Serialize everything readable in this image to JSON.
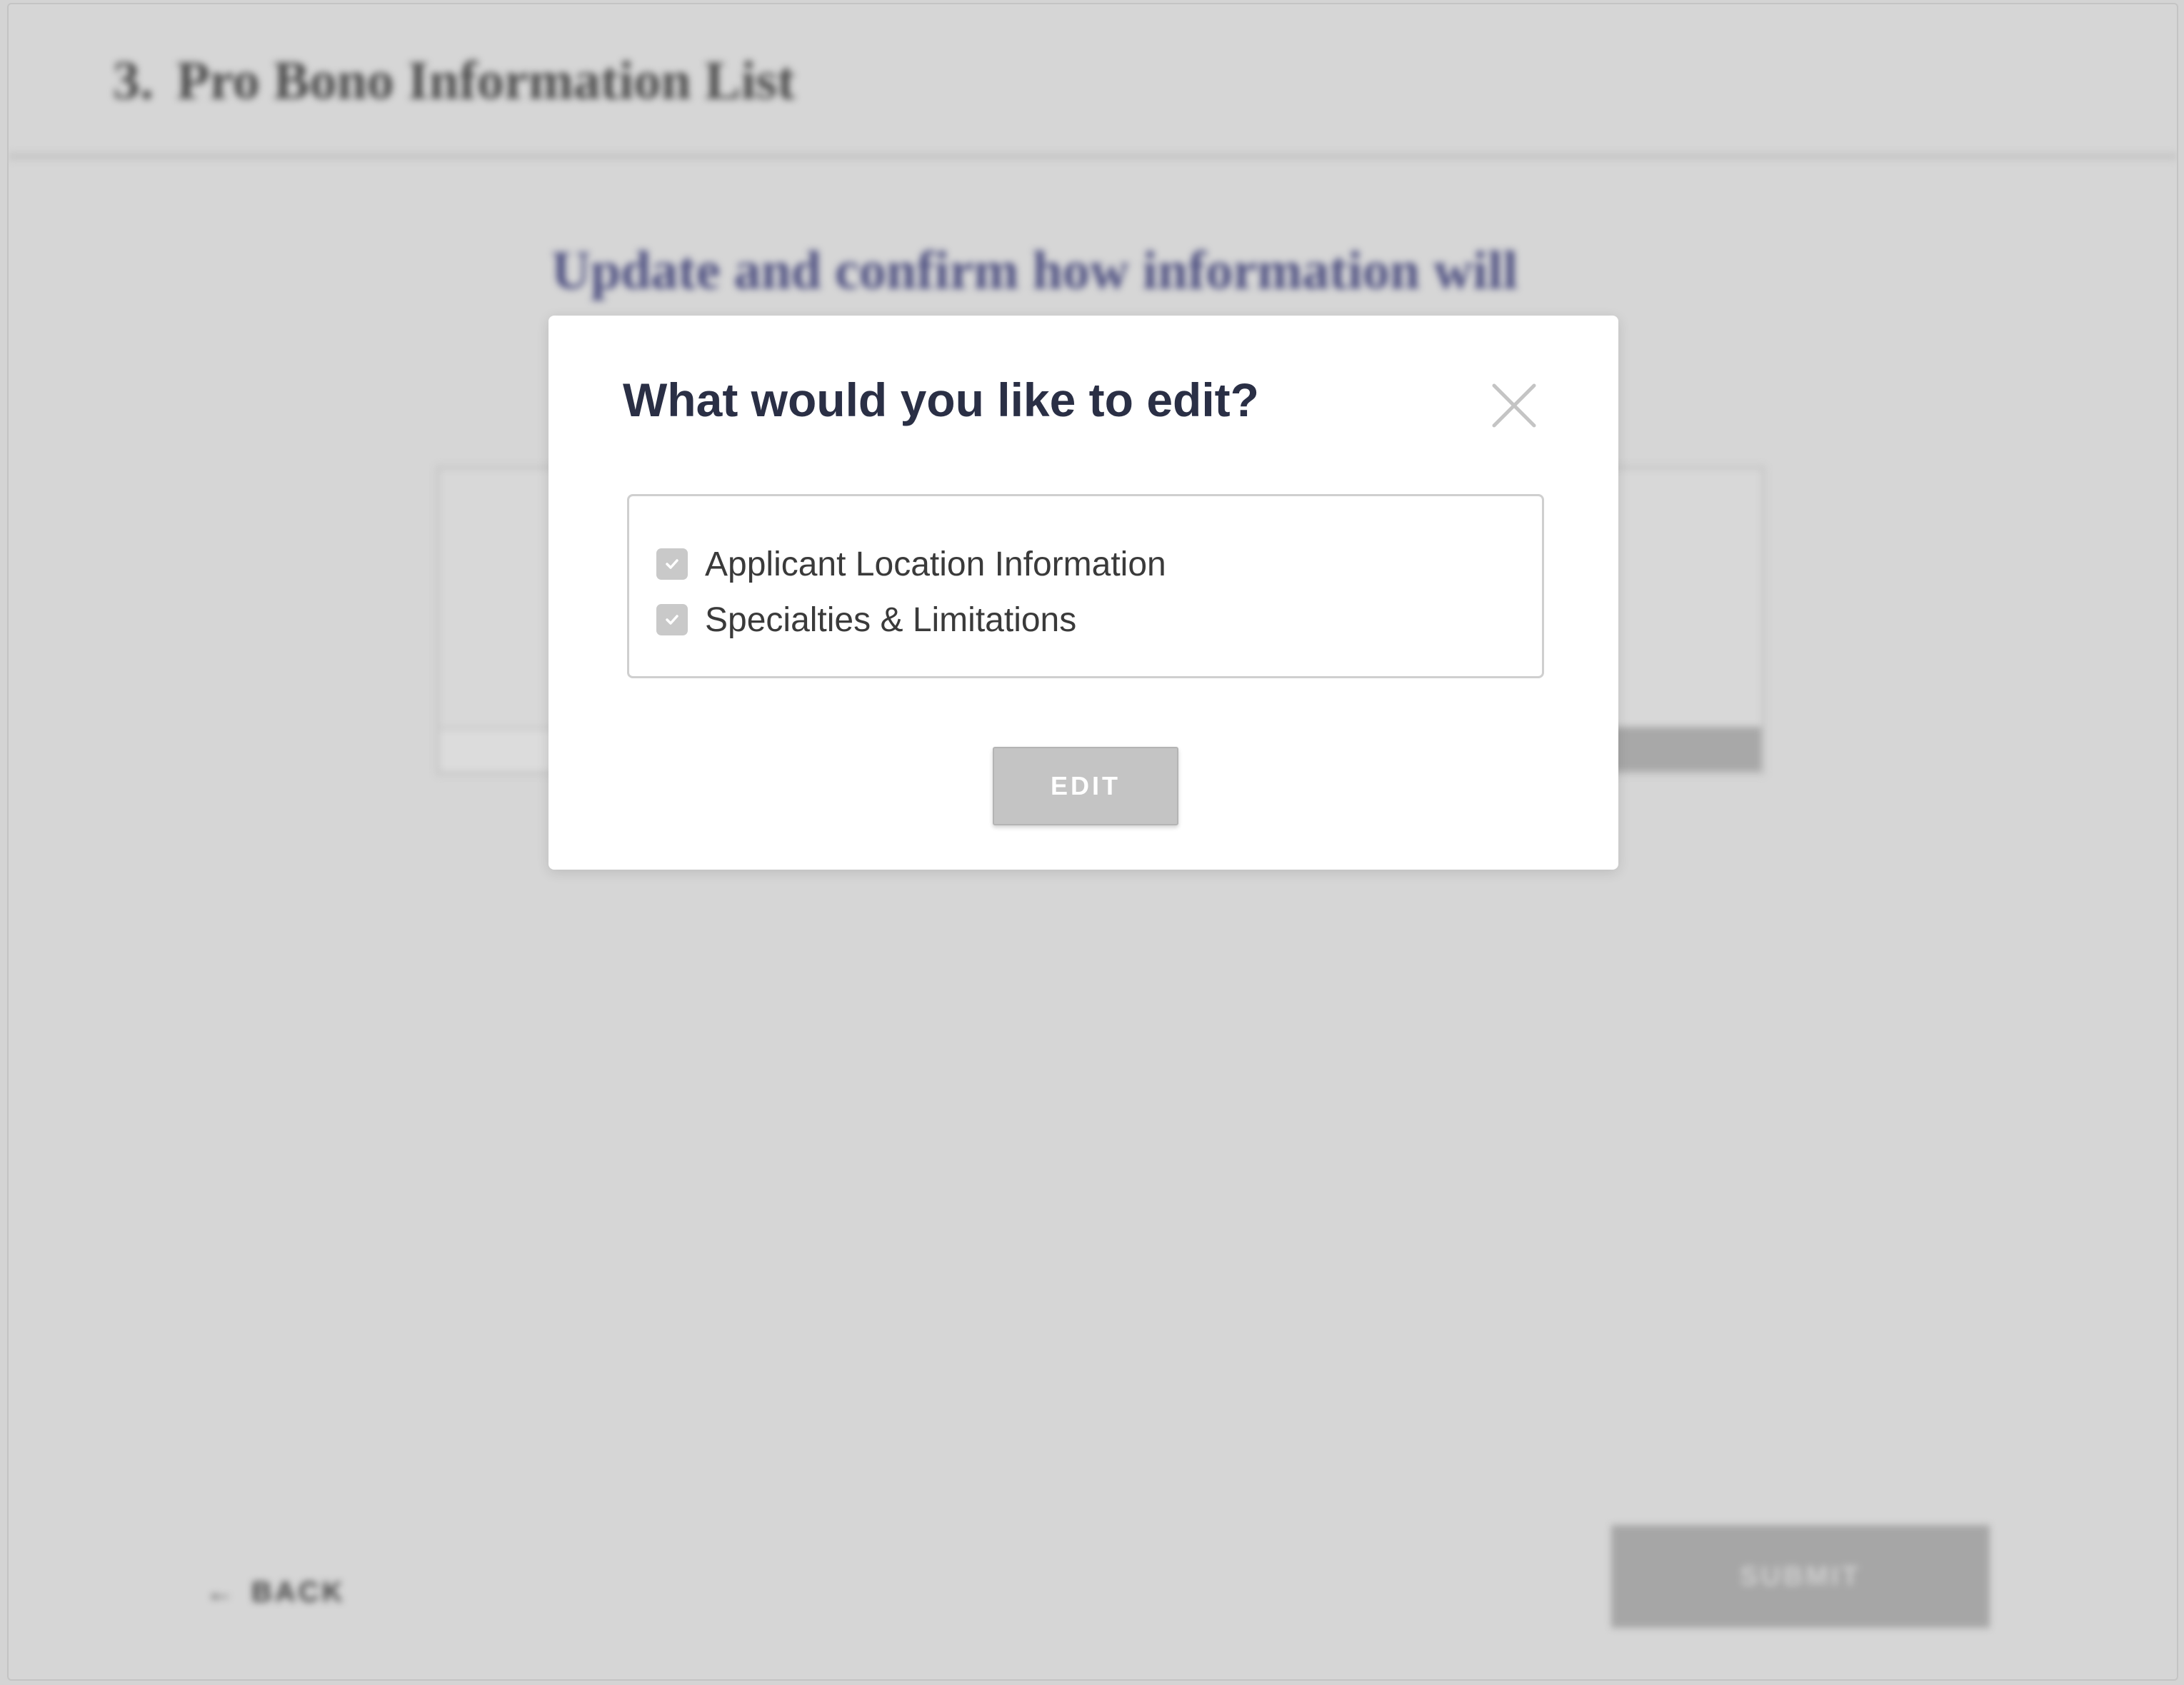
{
  "background": {
    "step_number": "3.",
    "step_title": "Pro Bono Information List",
    "subtitle": "Update and confirm how information will",
    "back_label": "BACK",
    "submit_label": "SUBMIT"
  },
  "modal": {
    "title": "What would you like to edit?",
    "options": [
      {
        "label": "Applicant Location Information",
        "checked": true
      },
      {
        "label": "Specialties & Limitations",
        "checked": true
      }
    ],
    "edit_label": "EDIT",
    "close_icon": "close-icon"
  },
  "colors": {
    "overlay": "#d4d4d4",
    "title_text": "#2a2f45",
    "subtitle_text": "#4d4f80",
    "button_disabled": "#c4c4c4",
    "checkbox_checked": "#c9c9c9"
  }
}
